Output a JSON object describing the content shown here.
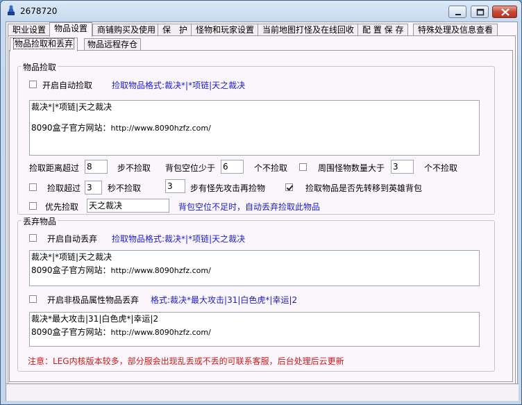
{
  "window": {
    "title": "2678720"
  },
  "main_tabs": [
    "职业设置",
    "物品设置",
    "商铺购买及使用",
    "保　护",
    "怪物和玩家设置",
    "当前地图打怪及在线回收",
    "配 置 保 存",
    "特殊处理及信息查看"
  ],
  "sub_tabs": [
    "物品捡取和丢弃",
    "物品远程存仓"
  ],
  "pickup": {
    "group_label": "物品捡取",
    "auto_pickup_label": "开启自动捡取",
    "auto_pickup_checked": false,
    "format_hint": "捡取物品格式:裁决*|*项链|天之裁决",
    "list_line1": "裁决*|*项链|天之裁决",
    "list_line2_prefix": "8090盒子官方网站：",
    "list_line2_url": "http://www.8090hzfz.com/",
    "distance_prefix": "捡取距离超过",
    "distance_value": "8",
    "distance_suffix": "步不捡取",
    "bag_prefix": "背包空位少于",
    "bag_value": "6",
    "bag_suffix": "个不捡取",
    "monster_label": "周围怪物数量大于",
    "monster_checked": false,
    "monster_value": "3",
    "monster_suffix": "个不捡取",
    "timeout_label": "捡取超过",
    "timeout_checked": false,
    "timeout_value": "3",
    "timeout_suffix": "秒不捡取",
    "attack_value": "3",
    "attack_suffix": "步有怪先攻击再捡物",
    "transfer_label": "捡取物品是否先转移到英雄背包",
    "transfer_checked": true,
    "priority_label": "优先捡取",
    "priority_checked": false,
    "priority_value": "天之裁决",
    "bag_full_hint": "背包空位不足时，自动丢弃捡取此物品"
  },
  "discard": {
    "group_label": "丢弃物品",
    "auto_discard_label": "开启自动丢弃",
    "auto_discard_checked": false,
    "format_hint": "捡取物品格式:裁决*|*项链|天之裁决",
    "list_line1": "裁决*|*项链|天之裁决",
    "list_line2_prefix": "8090盒子官方网站：",
    "list_line2_url": "http://www.8090hzfz.com/",
    "nonextreme_label": "开启非极品属性物品丢弃",
    "nonextreme_checked": false,
    "nonextreme_hint": "格式:裁决*最大攻击|31|白色虎*|幸运|2",
    "attr_line1": "裁决*最大攻击|31|白色虎*|幸运|2",
    "attr_line2_prefix": "8090盒子官方网站：",
    "attr_line2_url": "http://www.8090hzfz.com/"
  },
  "notice": "注意：LEG内核版本较多，部分服会出现乱丢或不丢的可联系客服，后台处理后云更新"
}
